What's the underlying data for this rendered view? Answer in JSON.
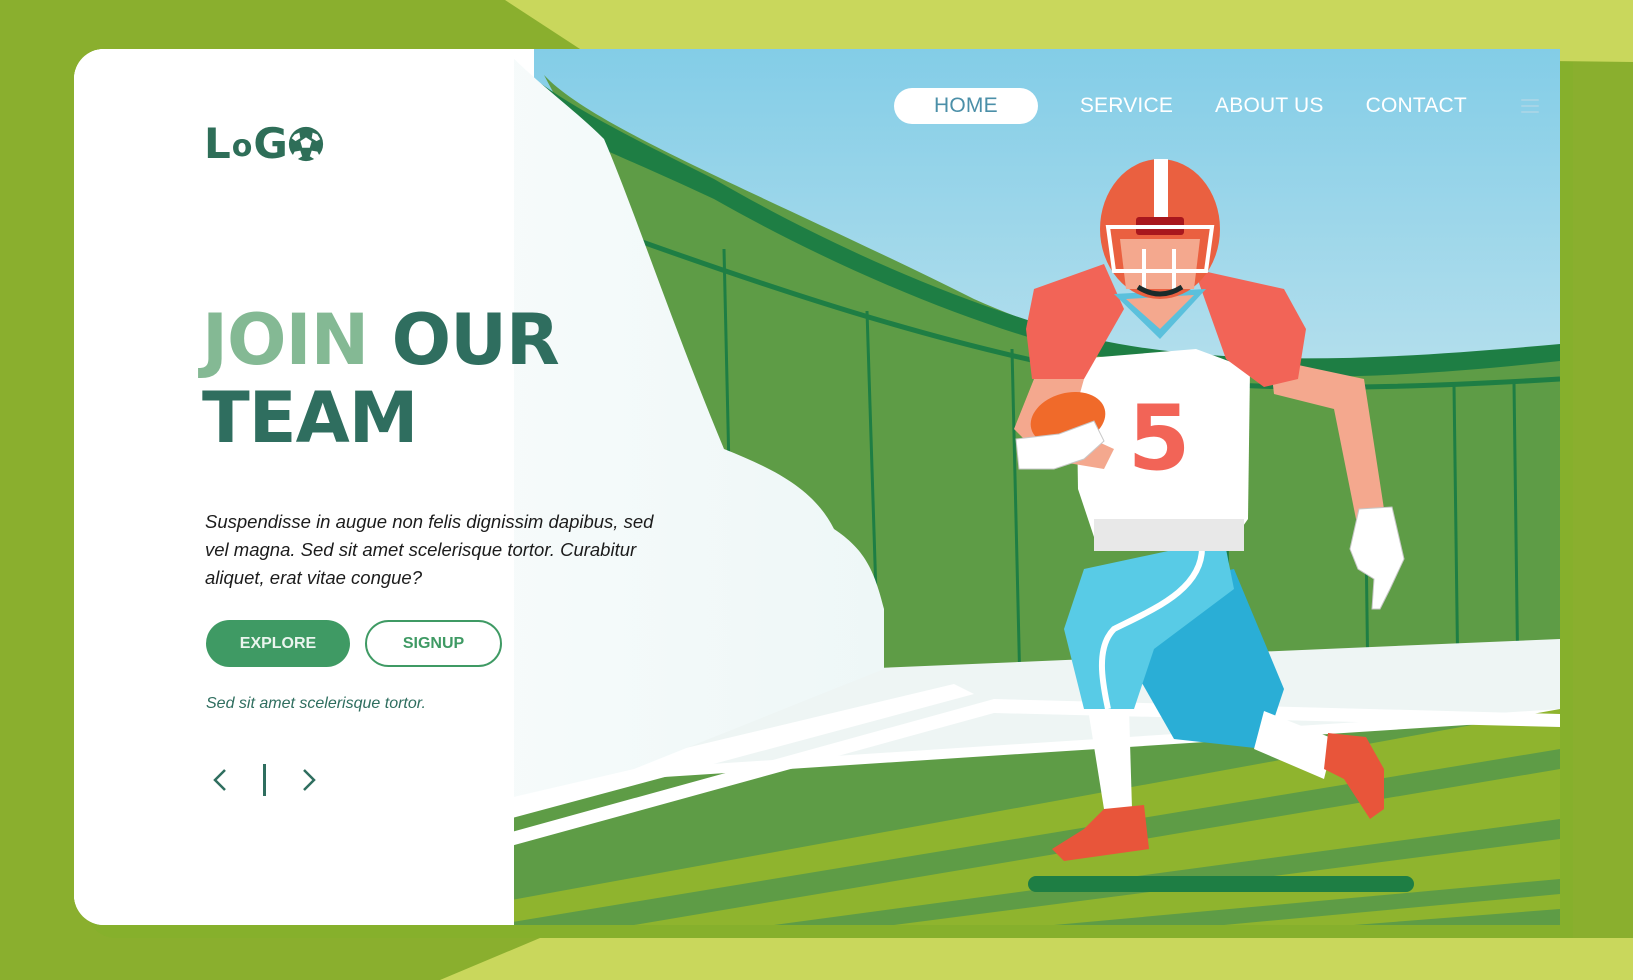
{
  "colors": {
    "outer_green": "#8aaf2e",
    "outer_lime": "#c9d75c",
    "sky": "#88d0e8",
    "stadium_green": "#5e9c46",
    "stadium_dark": "#1e7e44",
    "field_light": "#8fb42e",
    "accent_green": "#3f9a64",
    "heading_dark": "#2f6e5f",
    "heading_light": "#84b994"
  },
  "logo": {
    "text_l": "L",
    "text_o": "o",
    "text_g": "G",
    "icon": "soccer-ball-icon"
  },
  "nav": {
    "items": [
      {
        "label": "HOME",
        "active": true
      },
      {
        "label": "SERVICE",
        "active": false
      },
      {
        "label": "ABOUT US",
        "active": false
      },
      {
        "label": "CONTACT",
        "active": false
      }
    ],
    "menu_icon": "hamburger-icon"
  },
  "hero": {
    "title_light": "JOIN",
    "title_dark_1": "OUR",
    "title_dark_2": "TEAM",
    "description": "Suspendisse in augue non felis dignissim dapibus, sed vel magna. Sed sit amet scelerisque tortor. Curabitur aliquet, erat vitae congue?",
    "primary_button": "EXPLORE",
    "secondary_button": "SIGNUP",
    "caption": "Sed sit amet scelerisque tortor."
  },
  "pager": {
    "prev_icon": "chevron-left-icon",
    "next_icon": "chevron-right-icon"
  },
  "illustration": {
    "subject": "american-football-player",
    "jersey_number": "5"
  }
}
